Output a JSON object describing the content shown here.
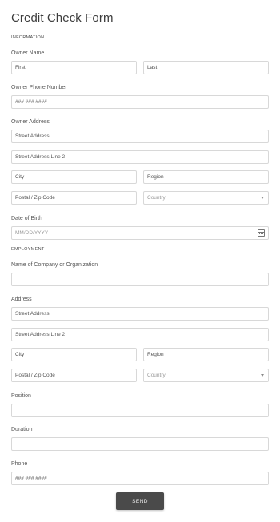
{
  "form": {
    "title": "Credit Check Form",
    "sections": {
      "information": "INFORMATION",
      "employment": "EMPLOYMENT"
    },
    "owner_name": {
      "label": "Owner Name",
      "first": "First",
      "last": "Last"
    },
    "owner_phone": {
      "label": "Owner Phone Number",
      "placeholder": "### ### ####"
    },
    "owner_address": {
      "label": "Owner Address",
      "street": "Street Address",
      "street2": "Street Address Line 2",
      "city": "City",
      "region": "Region",
      "postal": "Postal / Zip Code",
      "country": "Country"
    },
    "dob": {
      "label": "Date of Birth",
      "placeholder": "MM/DD/YYYY"
    },
    "company": {
      "label": "Name of Company or Organization",
      "value": ""
    },
    "address": {
      "label": "Address",
      "street": "Street Address",
      "street2": "Street Address Line 2",
      "city": "City",
      "region": "Region",
      "postal": "Postal / Zip Code",
      "country": "Country"
    },
    "position": {
      "label": "Position",
      "value": ""
    },
    "duration": {
      "label": "Duration",
      "value": ""
    },
    "phone": {
      "label": "Phone",
      "placeholder": "### ### ####"
    },
    "send_label": "SEND"
  }
}
